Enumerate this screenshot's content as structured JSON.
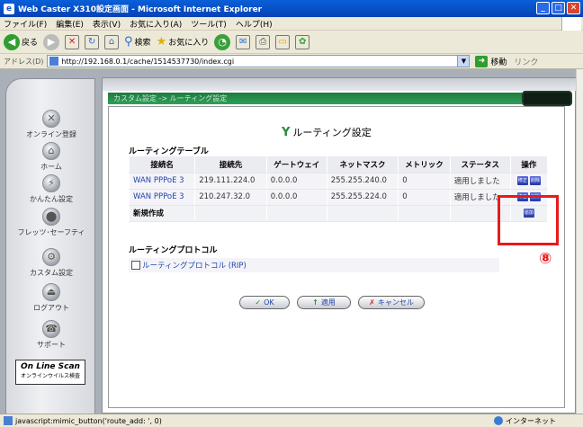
{
  "window": {
    "title": "Web Caster X310設定画面 - Microsoft Internet Explorer"
  },
  "menu": [
    "ファイル(F)",
    "編集(E)",
    "表示(V)",
    "お気に入り(A)",
    "ツール(T)",
    "ヘルプ(H)"
  ],
  "toolbar": {
    "back": "戻る",
    "search": "検索",
    "favorites": "お気に入り"
  },
  "address": {
    "label": "アドレス(D)",
    "url": "http://192.168.0.1/cache/1514537730/index.cgi",
    "go": "移動",
    "links": "リンク"
  },
  "sidebar": {
    "items": [
      {
        "label": "オンライン登録",
        "icon": "✕"
      },
      {
        "label": "ホーム",
        "icon": "⌂"
      },
      {
        "label": "かんたん設定",
        "icon": "⚡"
      },
      {
        "label": "フレッツ･セーフティ",
        "icon": "⬤"
      },
      {
        "label": "カスタム設定",
        "icon": "⚙"
      },
      {
        "label": "ログアウト",
        "icon": "⏏"
      },
      {
        "label": "サポート",
        "icon": "☎"
      }
    ],
    "scan": {
      "title": "On Line Scan",
      "sub": "オンラインウイルス検査"
    }
  },
  "breadcrumb": "カスタム設定 -> ルーティング設定",
  "page_title": "ルーティング設定",
  "routing_table": {
    "section_title": "ルーティングテーブル",
    "headers": [
      "接続名",
      "接続先",
      "ゲートウェイ",
      "ネットマスク",
      "メトリック",
      "ステータス",
      "操作"
    ],
    "rows": [
      {
        "name": "WAN PPPoE 3",
        "dest": "219.111.224.0",
        "gw": "0.0.0.0",
        "mask": "255.255.240.0",
        "metric": "0",
        "status": "適用しました",
        "edit": "修正",
        "delete": "削除"
      },
      {
        "name": "WAN PPPoE 3",
        "dest": "210.247.32.0",
        "gw": "0.0.0.0",
        "mask": "255.255.224.0",
        "metric": "0",
        "status": "適用しました",
        "edit": "修正",
        "delete": "削除"
      }
    ],
    "new_label": "新規作成",
    "add": "追加"
  },
  "annotation": {
    "number": "⑧",
    "color": "#e81a1a"
  },
  "protocol": {
    "section_title": "ルーティングプロトコル",
    "rip_label": "ルーティングプロトコル (RIP)"
  },
  "buttons": {
    "ok": "OK",
    "apply": "適用",
    "cancel": "キャンセル"
  },
  "status_bar": {
    "text": "javascript:mimic_button('route_add: ', 0)",
    "zone": "インターネット"
  }
}
